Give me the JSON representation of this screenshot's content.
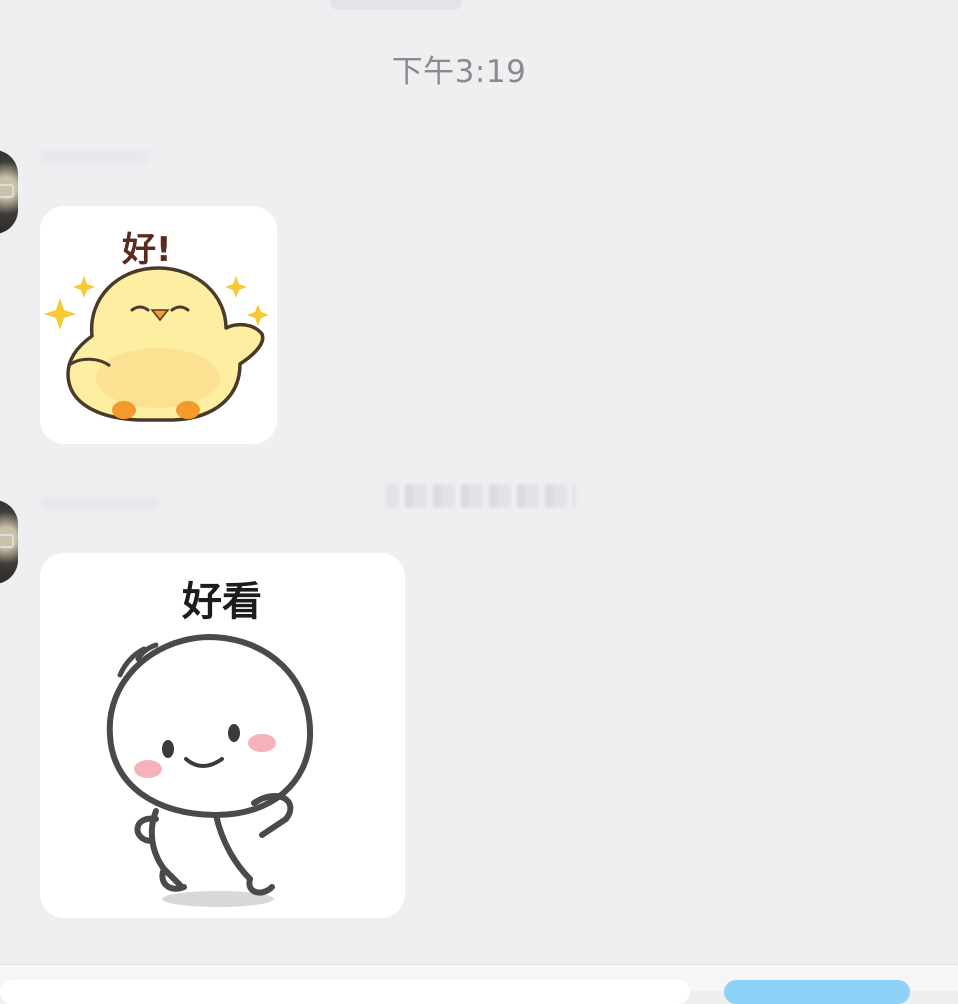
{
  "chat": {
    "timestamp": "下午3:19",
    "messages": [
      {
        "type": "sticker",
        "caption": "好!"
      },
      {
        "type": "sticker",
        "caption": "好看"
      }
    ]
  },
  "colors": {
    "background": "#efeff2",
    "bubble": "#ffffff",
    "send_button": "#8fd2f7"
  },
  "icons": {
    "sticker_1": "yellow-chick-sticker",
    "sticker_2": "round-head-cartoon-sticker"
  }
}
